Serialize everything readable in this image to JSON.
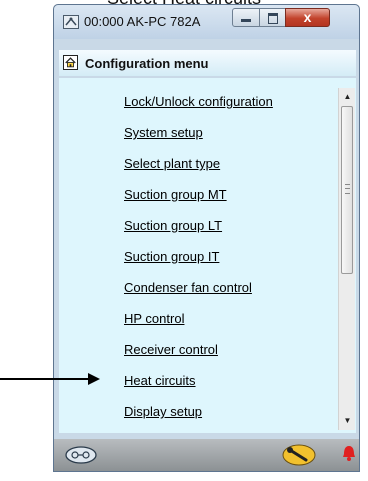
{
  "caption": "Select Heat circuits",
  "window": {
    "title": "00:000 AK-PC 782A",
    "close_glyph": "x",
    "icons": {
      "app": "ak-device-icon",
      "minimize": "minimize-icon",
      "maximize": "maximize-icon",
      "close": "close-icon"
    }
  },
  "header": {
    "title": "Configuration menu",
    "icon": "home-icon"
  },
  "menu": {
    "items": [
      {
        "label": "Lock/Unlock configuration"
      },
      {
        "label": "System setup"
      },
      {
        "label": "Select plant type"
      },
      {
        "label": "Suction group MT"
      },
      {
        "label": "Suction group LT"
      },
      {
        "label": "Suction group IT"
      },
      {
        "label": "Condenser fan control"
      },
      {
        "label": "HP control"
      },
      {
        "label": "Receiver control"
      },
      {
        "label": "Heat circuits"
      },
      {
        "label": "Display setup"
      }
    ]
  },
  "scrollbar": {
    "up_glyph": "▲",
    "down_glyph": "▼"
  },
  "bottom_bar": {
    "icons": [
      "login-keys-icon",
      "service-wrench-icon",
      "alarm-bell-icon"
    ],
    "colors": {
      "wrench_badge": "#f2c12e",
      "alarm": "#e02020"
    }
  },
  "annotation": {
    "arrow_target": "Heat circuits"
  }
}
